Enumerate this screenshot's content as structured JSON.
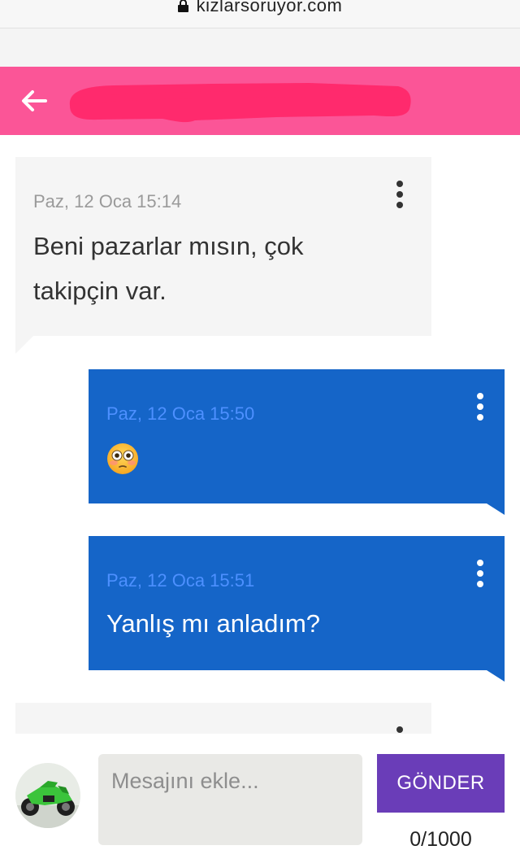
{
  "browser": {
    "url": "kizlarsoruyor.com",
    "lock_icon": "lock-icon"
  },
  "header": {
    "back_icon": "arrow-left-icon",
    "background_color": "#fb5597",
    "redaction_color": "#ff2a6d"
  },
  "messages": [
    {
      "direction": "incoming",
      "timestamp": "Paz, 12 Oca 15:14",
      "text_lines": [
        "Beni pazarlar mısın, çok",
        "takipçin var."
      ]
    },
    {
      "direction": "outgoing",
      "timestamp": "Paz, 12 Oca 15:50",
      "emoji": "flushed-face-emoji"
    },
    {
      "direction": "outgoing",
      "timestamp": "Paz, 12 Oca 15:51",
      "text_lines": [
        "Yanlış mı anladım?"
      ]
    },
    {
      "direction": "incoming",
      "partial": true
    }
  ],
  "composer": {
    "avatar": "motorcycle-avatar",
    "placeholder": "Mesajını ekle...",
    "send_label": "GÖNDER",
    "counter": "0/1000"
  },
  "colors": {
    "incoming_bubble": "#f5f5f5",
    "outgoing_bubble": "#1565c8",
    "outgoing_timestamp": "#4d90ff",
    "send_button": "#6a3db8"
  }
}
